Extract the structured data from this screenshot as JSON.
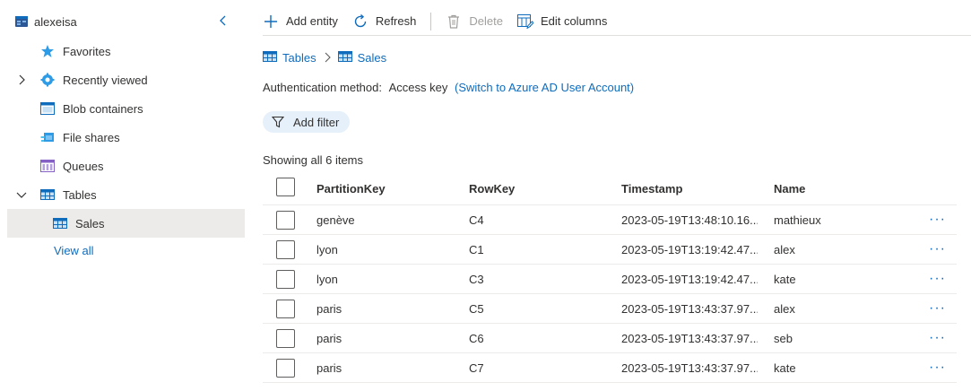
{
  "sidebar": {
    "account_name": "alexeisa",
    "items": [
      {
        "label": "Favorites"
      },
      {
        "label": "Recently viewed"
      },
      {
        "label": "Blob containers"
      },
      {
        "label": "File shares"
      },
      {
        "label": "Queues"
      },
      {
        "label": "Tables"
      },
      {
        "label": "Sales"
      }
    ],
    "view_all": "View all"
  },
  "toolbar": {
    "add_entity": "Add entity",
    "refresh": "Refresh",
    "delete": "Delete",
    "edit_columns": "Edit columns"
  },
  "breadcrumb": {
    "tables": "Tables",
    "sales": "Sales"
  },
  "auth": {
    "label": "Authentication method:",
    "value": "Access key",
    "switch_link": "(Switch to Azure AD User Account)"
  },
  "filter": {
    "label": "Add filter"
  },
  "status": {
    "showing": "Showing all 6 items"
  },
  "table": {
    "columns": [
      "PartitionKey",
      "RowKey",
      "Timestamp",
      "Name"
    ],
    "rows": [
      {
        "partition": "genève",
        "row": "C4",
        "timestamp": "2023-05-19T13:48:10.16...",
        "name": "mathieux"
      },
      {
        "partition": "lyon",
        "row": "C1",
        "timestamp": "2023-05-19T13:19:42.47...",
        "name": "alex"
      },
      {
        "partition": "lyon",
        "row": "C3",
        "timestamp": "2023-05-19T13:19:42.47...",
        "name": "kate"
      },
      {
        "partition": "paris",
        "row": "C5",
        "timestamp": "2023-05-19T13:43:37.97...",
        "name": "alex"
      },
      {
        "partition": "paris",
        "row": "C6",
        "timestamp": "2023-05-19T13:43:37.97...",
        "name": "seb"
      },
      {
        "partition": "paris",
        "row": "C7",
        "timestamp": "2023-05-19T13:43:37.97...",
        "name": "kate"
      }
    ],
    "more_glyph": "···"
  },
  "colors": {
    "accent": "#0f6cbd",
    "selected_bg": "#edebe9",
    "filter_bg": "#e6f0fa"
  }
}
